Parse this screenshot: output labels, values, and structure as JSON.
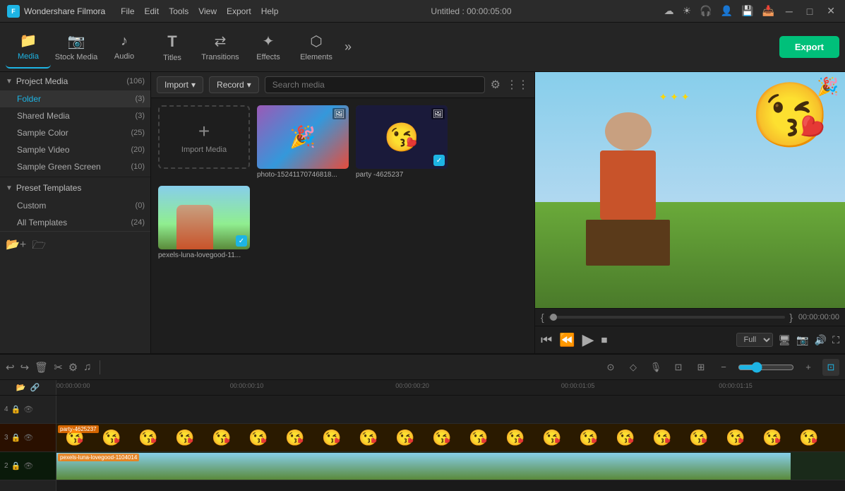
{
  "app": {
    "name": "Wondershare Filmora",
    "logo": "F",
    "title": "Untitled : 00:00:05:00"
  },
  "menu": {
    "items": [
      "File",
      "Edit",
      "Tools",
      "View",
      "Export",
      "Help"
    ]
  },
  "window_controls": {
    "minimize": "─",
    "maximize": "□",
    "close": "✕"
  },
  "title_bar_icons": [
    "☁",
    "☀",
    "🎧",
    "👤",
    "💾",
    "📥"
  ],
  "toolbar": {
    "tools": [
      {
        "id": "media",
        "icon": "📁",
        "label": "Media",
        "active": true
      },
      {
        "id": "stock",
        "icon": "📷",
        "label": "Stock Media",
        "active": false
      },
      {
        "id": "audio",
        "icon": "🎵",
        "label": "Audio",
        "active": false
      },
      {
        "id": "titles",
        "icon": "T",
        "label": "Titles",
        "active": false
      },
      {
        "id": "transitions",
        "icon": "⇄",
        "label": "Transitions",
        "active": false
      },
      {
        "id": "effects",
        "icon": "✨",
        "label": "Effects",
        "active": false
      },
      {
        "id": "elements",
        "icon": "⬡",
        "label": "Elements",
        "active": false
      }
    ],
    "expand_label": "»",
    "export_label": "Export"
  },
  "left_panel": {
    "project_media": {
      "label": "Project Media",
      "count": "(106)",
      "expanded": true
    },
    "items": [
      {
        "label": "Folder",
        "count": "(3)",
        "active": true
      },
      {
        "label": "Shared Media",
        "count": "(3)"
      },
      {
        "label": "Sample Color",
        "count": "(25)"
      },
      {
        "label": "Sample Video",
        "count": "(20)"
      },
      {
        "label": "Sample Green Screen",
        "count": "(10)"
      }
    ],
    "preset_templates": {
      "label": "Preset Templates",
      "expanded": true
    },
    "template_items": [
      {
        "label": "Custom",
        "count": "(0)"
      },
      {
        "label": "All Templates",
        "count": "(24)"
      }
    ]
  },
  "media_panel": {
    "import_label": "Import",
    "record_label": "Record",
    "search_placeholder": "Search media",
    "import_media_label": "Import Media",
    "media_items": [
      {
        "id": "photo1",
        "name": "photo-15241170746818...",
        "has_check": false
      },
      {
        "id": "party",
        "name": "party -4625237",
        "has_check": true
      },
      {
        "id": "pexels",
        "name": "pexels-luna-lovegood-11...",
        "has_check": true
      }
    ]
  },
  "preview": {
    "timecode": "00:00:00:00",
    "playback_quality": "Full",
    "bracket_open": "{",
    "bracket_close": "}"
  },
  "timeline": {
    "timecodes": [
      "00:00:00:00",
      "00:00:00:10",
      "00:00:00:20",
      "00:00:01:05",
      "00:00:01:15"
    ],
    "tracks": [
      {
        "num": "4",
        "name": "",
        "type": "empty"
      },
      {
        "num": "3",
        "name": "party-4625237",
        "type": "emoji"
      },
      {
        "num": "2",
        "name": "pexels-luna-lovegood-1104014",
        "type": "pexels"
      }
    ]
  }
}
